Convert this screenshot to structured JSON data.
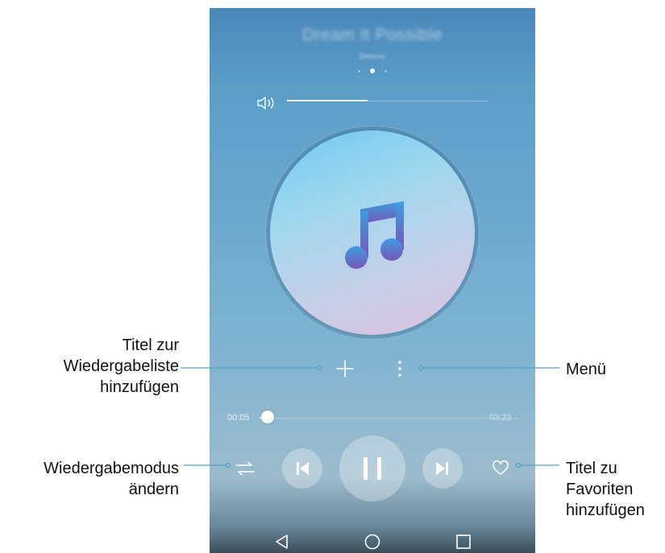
{
  "player": {
    "song_title": "Dream It Possible",
    "artist": "Delacey",
    "current_time": "00:05",
    "total_time": "03:23",
    "progress_fraction": 0.03,
    "volume_fraction": 0.4
  },
  "icons": {
    "volume": "speaker-icon",
    "add": "plus-icon",
    "menu": "vertical-dots-icon",
    "mode": "repeat-icon",
    "prev": "skip-previous-icon",
    "play": "pause-icon",
    "next": "skip-next-icon",
    "favorite": "heart-icon",
    "back": "back-triangle-icon",
    "home": "home-circle-icon",
    "recent": "recent-square-icon"
  },
  "colors": {
    "accent": "#ffffff",
    "note_top": "#3a86d4",
    "note_bottom": "#7a56b8"
  },
  "annotations": {
    "add_to_playlist": [
      "Titel zur",
      "Wiedergabeliste",
      "hinzufügen"
    ],
    "play_mode": [
      "Wiedergabemodus",
      "ändern"
    ],
    "menu": [
      "Menü"
    ],
    "favorites": [
      "Titel zu",
      "Favoriten",
      "hinzufügen"
    ]
  }
}
